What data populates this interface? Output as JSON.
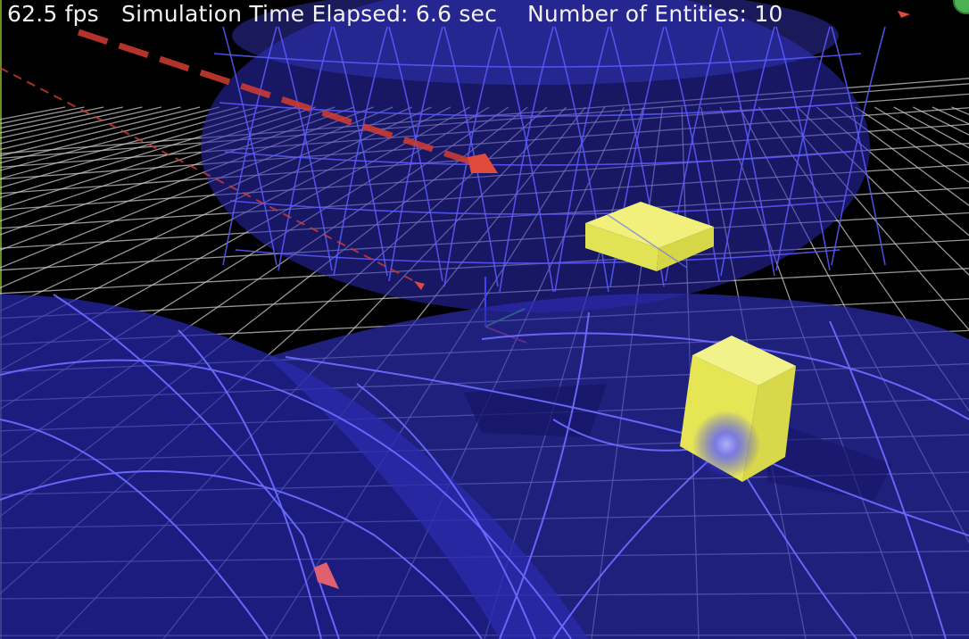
{
  "hud": {
    "fps": "62.5 fps",
    "sim_time": "Simulation Time Elapsed: 6.6 sec",
    "entities": "Number of Entities: 10"
  },
  "scene": {
    "background_color": "#000000",
    "grid_color": "#c8c8c8",
    "shield_fill_color": "#2a2ab4",
    "shield_wire_color": "#5a5aff",
    "entity_box_color": "#ecec5a",
    "projectile_color": "#d23c32",
    "axis_x_color": "#e03030",
    "axis_y_color": "#30d030",
    "axis_z_color": "#4040ff"
  }
}
